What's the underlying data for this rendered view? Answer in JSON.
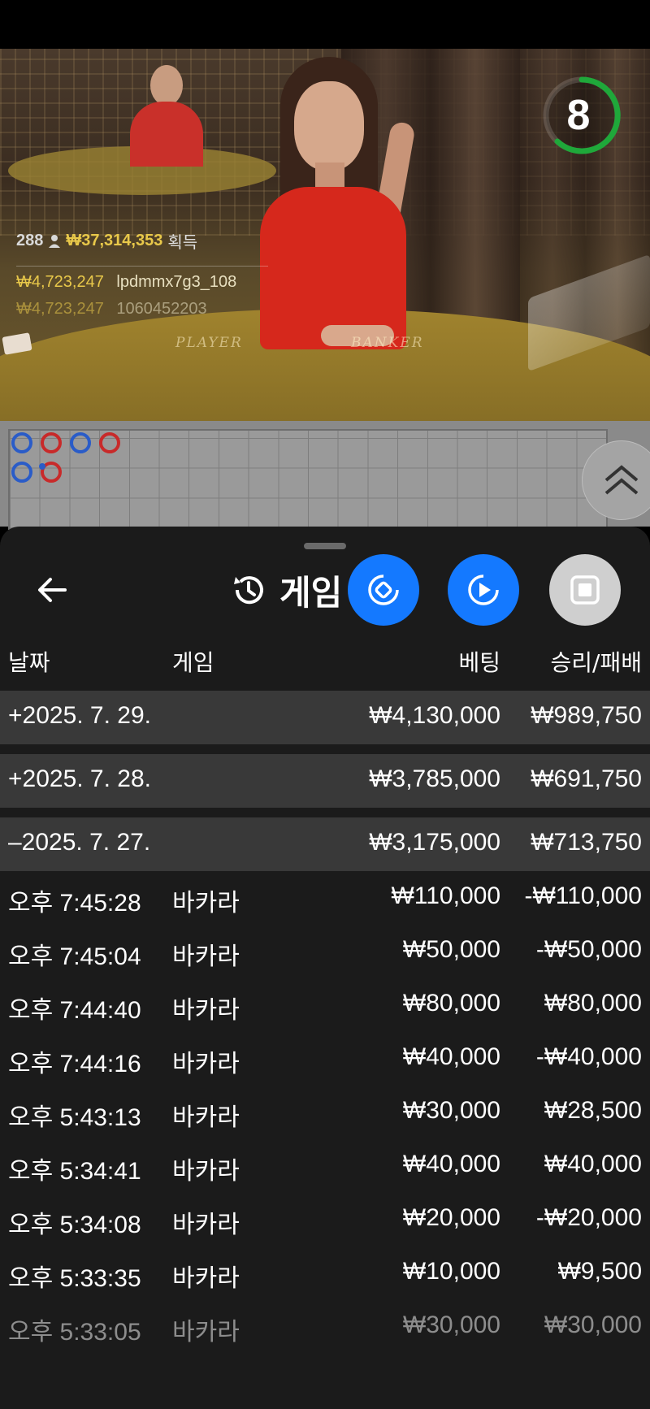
{
  "video": {
    "timer": "8",
    "overlay": {
      "players": "288",
      "total": "₩37,314,353",
      "total_label": "획득",
      "win1_amount": "₩4,723,247",
      "win1_user": "lpdmmx7g3_108",
      "win2_amount": "₩4,723,247",
      "win2_user": "1060452203"
    },
    "table_labels": {
      "player": "PLAYER",
      "banker": "BANKER"
    }
  },
  "roadmap": {
    "beads": [
      {
        "side": "player"
      },
      {
        "side": "banker"
      },
      {
        "side": "player"
      },
      {
        "side": "banker"
      },
      {
        "side": "player"
      },
      {
        "side": "banker"
      }
    ]
  },
  "sheet": {
    "title": "게임",
    "icons": [
      "back-arrow-icon",
      "history-icon",
      "swap-icon",
      "replay-icon",
      "stop-icon"
    ],
    "columns": {
      "date": "날짜",
      "game": "게임",
      "bet": "베팅",
      "result": "승리/패배"
    },
    "days": [
      {
        "date": "+2025. 7. 29.",
        "bet": "₩4,130,000",
        "result": "₩989,750"
      },
      {
        "date": "+2025. 7. 28.",
        "bet": "₩3,785,000",
        "result": "₩691,750"
      },
      {
        "date": "–2025. 7. 27.",
        "bet": "₩3,175,000",
        "result": "₩713,750"
      }
    ],
    "rounds": [
      {
        "time": "오후 7:45:28",
        "game": "바카라",
        "bet": "₩110,000",
        "result": "-₩110,000"
      },
      {
        "time": "오후 7:45:04",
        "game": "바카라",
        "bet": "₩50,000",
        "result": "-₩50,000"
      },
      {
        "time": "오후 7:44:40",
        "game": "바카라",
        "bet": "₩80,000",
        "result": "₩80,000"
      },
      {
        "time": "오후 7:44:16",
        "game": "바카라",
        "bet": "₩40,000",
        "result": "-₩40,000"
      },
      {
        "time": "오후 5:43:13",
        "game": "바카라",
        "bet": "₩30,000",
        "result": "₩28,500"
      },
      {
        "time": "오후 5:34:41",
        "game": "바카라",
        "bet": "₩40,000",
        "result": "₩40,000"
      },
      {
        "time": "오후 5:34:08",
        "game": "바카라",
        "bet": "₩20,000",
        "result": "-₩20,000"
      },
      {
        "time": "오후 5:33:35",
        "game": "바카라",
        "bet": "₩10,000",
        "result": "₩9,500"
      },
      {
        "time": "오후 5:33:05",
        "game": "바카라",
        "bet": "₩30,000",
        "result": "₩30,000"
      }
    ]
  },
  "colors": {
    "accent_blue": "#1479ff",
    "timer_green": "#1fa83a",
    "gold": "#e8c84a",
    "player_blue": "#2a5cc8",
    "banker_red": "#c82a2a"
  }
}
